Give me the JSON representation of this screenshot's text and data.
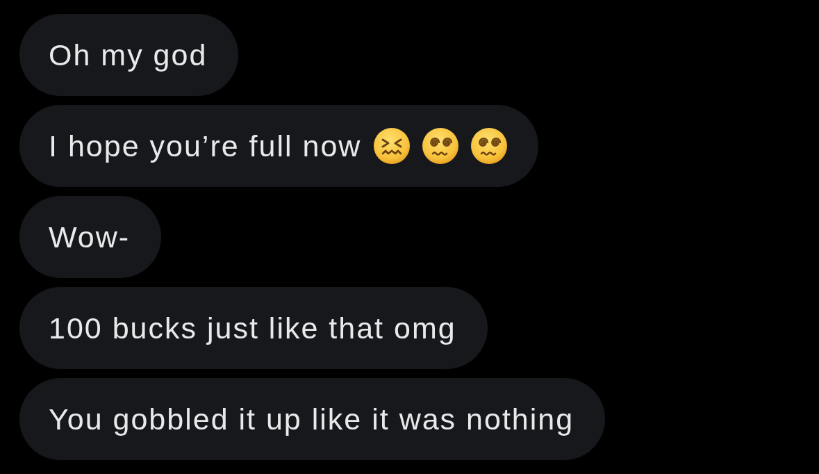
{
  "messages": [
    {
      "text": "Oh my god"
    },
    {
      "text": "I hope you’re full now",
      "emojis": [
        {
          "kind": "confounded"
        },
        {
          "kind": "dizzy"
        },
        {
          "kind": "dizzy"
        }
      ]
    },
    {
      "text": "Wow-"
    },
    {
      "text": "100 bucks just like that omg"
    },
    {
      "text": "You gobbled it up like it was nothing"
    }
  ]
}
